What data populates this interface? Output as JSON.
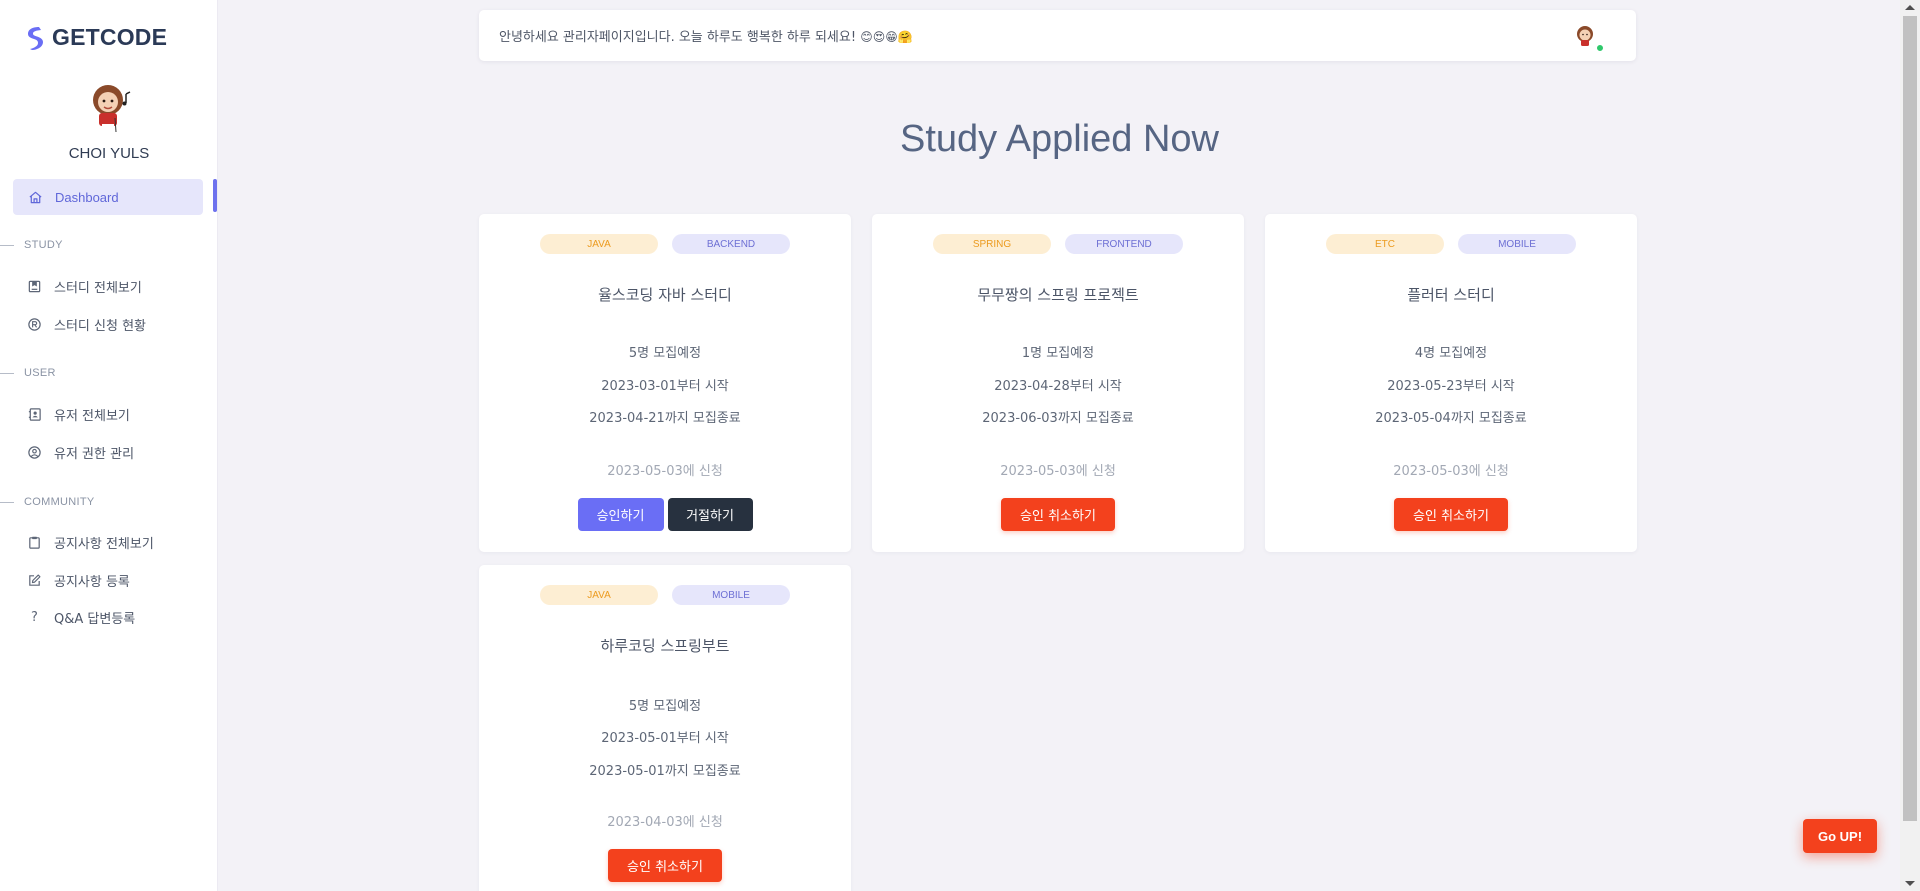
{
  "brand": {
    "name": "GETCODE"
  },
  "profile": {
    "name": "CHOI YULS"
  },
  "sidebar": {
    "active": {
      "label": "Dashboard",
      "icon": "home-icon"
    },
    "sections": [
      {
        "label": "STUDY",
        "items": [
          {
            "label": "스터디 전체보기",
            "icon": "bookmark-box-icon"
          },
          {
            "label": "스터디 신청 현황",
            "icon": "registered-icon"
          }
        ]
      },
      {
        "label": "USER",
        "items": [
          {
            "label": "유저 전체보기",
            "icon": "contacts-book-icon"
          },
          {
            "label": "유저 권한 관리",
            "icon": "user-circle-icon"
          }
        ]
      },
      {
        "label": "COMMUNITY",
        "items": [
          {
            "label": "공지사항 전체보기",
            "icon": "clipboard-icon"
          },
          {
            "label": "공지사항 등록",
            "icon": "edit-icon"
          },
          {
            "label": "Q&A 답변등록",
            "icon": "question-icon"
          }
        ]
      }
    ]
  },
  "topbar": {
    "greeting": "안녕하세요 관리자페이지입니다. 오늘 하루도 행복한 하루 되세요!",
    "emojis": "😊😍😁🤗"
  },
  "page": {
    "title": "Study Applied Now"
  },
  "cards": [
    {
      "lang": "JAVA",
      "field": "BACKEND",
      "title": "율스코딩 자바 스터디",
      "recruit": "5명 모집예정",
      "start": "2023-03-01부터 시작",
      "end": "2023-04-21까지 모집종료",
      "applied": "2023-05-03에 신청",
      "approve": "승인하기",
      "reject": "거절하기"
    },
    {
      "lang": "SPRING",
      "field": "FRONTEND",
      "title": "무무짱의 스프링 프로젝트",
      "recruit": "1명 모집예정",
      "start": "2023-04-28부터 시작",
      "end": "2023-06-03까지 모집종료",
      "applied": "2023-05-03에 신청",
      "cancel": "승인 취소하기"
    },
    {
      "lang": "ETC",
      "field": "MOBILE",
      "title": "플러터 스터디",
      "recruit": "4명 모집예정",
      "start": "2023-05-23부터 시작",
      "end": "2023-05-04까지 모집종료",
      "applied": "2023-05-03에 신청",
      "cancel": "승인 취소하기"
    },
    {
      "lang": "JAVA",
      "field": "MOBILE",
      "title": "하루코딩 스프링부트",
      "recruit": "5명 모집예정",
      "start": "2023-05-01부터 시작",
      "end": "2023-05-01까지 모집종료",
      "applied": "2023-04-03에 신청",
      "cancel": "승인 취소하기"
    }
  ],
  "go_up": "Go UP!",
  "colors": {
    "accent": "#6a6ef5",
    "danger": "#f3411d",
    "dark": "#27313f"
  }
}
